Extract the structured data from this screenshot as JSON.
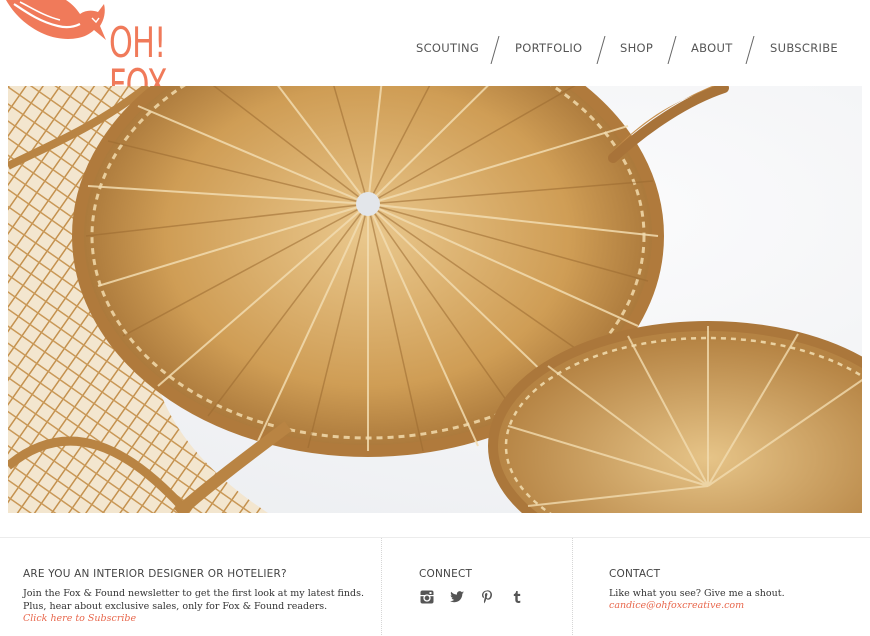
{
  "brand": {
    "name": "OH! FOX",
    "color": "#f07a5a"
  },
  "nav": {
    "items": [
      {
        "label": "SCOUTING"
      },
      {
        "label": "PORTFOLIO"
      },
      {
        "label": "SHOP"
      },
      {
        "label": "ABOUT"
      },
      {
        "label": "SUBSCRIBE"
      }
    ]
  },
  "footer": {
    "designer": {
      "heading": "ARE YOU AN INTERIOR DESIGNER OR HOTELIER?",
      "line1": "Join the Fox & Found newsletter to get the first look at my latest finds.",
      "line2": "Plus, hear about exclusive sales, only for Fox & Found readers.",
      "link": "Click here to Subscribe"
    },
    "connect": {
      "heading": "CONNECT",
      "icons": [
        "instagram-icon",
        "twitter-icon",
        "pinterest-icon",
        "tumblr-icon"
      ]
    },
    "contact": {
      "heading": "CONTACT",
      "line1": "Like what you see? Give me a shout.",
      "email": "candice@ohfoxcreative.com"
    }
  },
  "colors": {
    "accent": "#e8674c",
    "text": "#333333"
  }
}
